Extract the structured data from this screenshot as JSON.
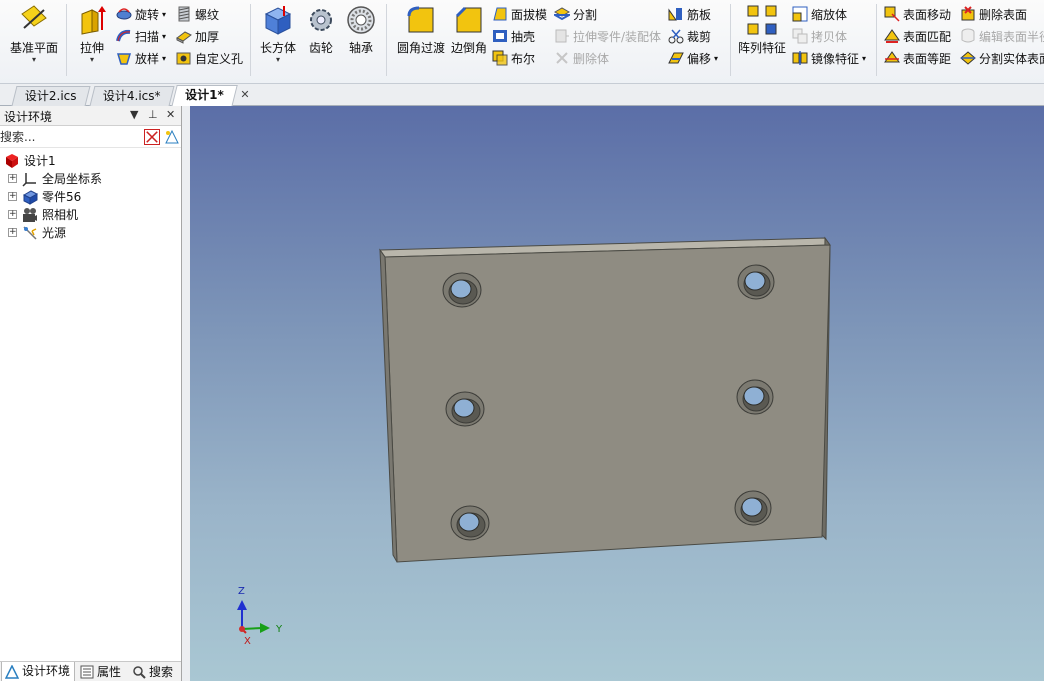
{
  "ribbon": {
    "datum_plane": "基准平面",
    "extrude": "拉伸",
    "revolve": "旋转",
    "sweep": "扫描",
    "loft": "放样",
    "thread": "螺纹",
    "thicken": "加厚",
    "custom_hole": "自定义孔",
    "box": "长方体",
    "gear": "齿轮",
    "bearing": "轴承",
    "fillet": "圆角过渡",
    "chamfer": "边倒角",
    "draft": "面拔模",
    "shell": "抽壳",
    "boolean": "布尔",
    "split": "分割",
    "stretch_part": "拉伸零件/装配体",
    "delete_body": "删除体",
    "rib": "筋板",
    "trim": "裁剪",
    "offset": "偏移",
    "pattern": "阵列特征",
    "scale_body": "缩放体",
    "copy_body": "拷贝体",
    "mirror": "镜像特征",
    "face_move": "表面移动",
    "face_match": "表面匹配",
    "face_offset": "表面等距",
    "delete_face": "删除表面",
    "edit_face_radius": "编辑表面半径",
    "split_solid_face": "分割实体表面"
  },
  "doc_tabs": [
    {
      "label": "设计2.ics"
    },
    {
      "label": "设计4.ics*"
    },
    {
      "label": "设计1*"
    }
  ],
  "panel": {
    "title": "设计环境",
    "search_placeholder": "搜索...",
    "tree": {
      "root": "设计1",
      "items": [
        {
          "label": "全局坐标系"
        },
        {
          "label": "零件56"
        },
        {
          "label": "照相机"
        },
        {
          "label": "光源"
        }
      ]
    },
    "tabs": [
      {
        "label": "设计环境"
      },
      {
        "label": "属性"
      },
      {
        "label": "搜索"
      }
    ]
  },
  "axes": {
    "z": "Z",
    "y": "Y",
    "x": "X"
  },
  "colors": {
    "plate_face": "#8f8c82",
    "plate_edge": "#4a4a44",
    "hole": "#8fb0d4"
  }
}
